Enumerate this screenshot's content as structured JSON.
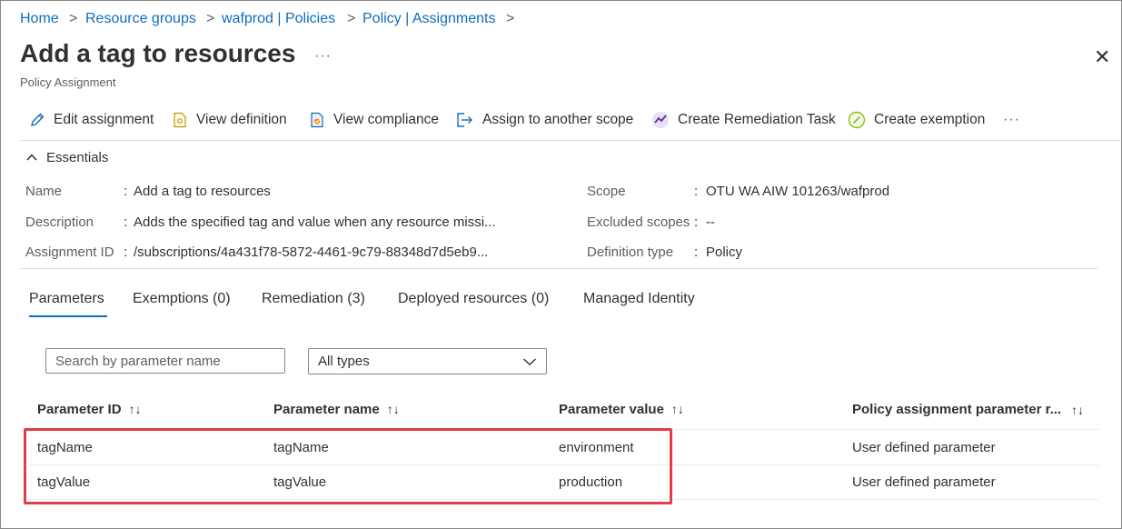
{
  "breadcrumb": {
    "items": [
      {
        "label": "Home"
      },
      {
        "label": "Resource groups"
      },
      {
        "label": "wafprod | Policies"
      },
      {
        "label": "Policy | Assignments"
      }
    ],
    "separator": ">"
  },
  "header": {
    "title": "Add a tag to resources",
    "subtitle": "Policy Assignment",
    "more": "···",
    "close": "✕"
  },
  "toolbar": {
    "items": [
      {
        "label": "Edit assignment",
        "icon": "pencil-icon"
      },
      {
        "label": "View definition",
        "icon": "document-icon"
      },
      {
        "label": "View compliance",
        "icon": "compliance-icon"
      },
      {
        "label": "Assign to another scope",
        "icon": "export-icon"
      },
      {
        "label": "Create Remediation Task",
        "icon": "remediation-icon"
      },
      {
        "label": "Create exemption",
        "icon": "exemption-icon"
      }
    ],
    "more": "···"
  },
  "essentials": {
    "heading": "Essentials",
    "left": [
      {
        "label": "Name",
        "value": "Add a tag to resources"
      },
      {
        "label": "Description",
        "value": "Adds the specified tag and value when any resource missi..."
      },
      {
        "label": "Assignment ID",
        "value": "/subscriptions/4a431f78-5872-4461-9c79-88348d7d5eb9..."
      }
    ],
    "right": [
      {
        "label": "Scope",
        "value": "OTU WA AIW 101263/wafprod"
      },
      {
        "label": "Excluded scopes",
        "value": "--"
      },
      {
        "label": "Definition type",
        "value": "Policy"
      }
    ]
  },
  "tabs": [
    {
      "label": "Parameters",
      "active": true
    },
    {
      "label": "Exemptions (0)"
    },
    {
      "label": "Remediation (3)"
    },
    {
      "label": "Deployed resources (0)"
    },
    {
      "label": "Managed Identity"
    }
  ],
  "filters": {
    "search_placeholder": "Search by parameter name",
    "type_value": "All types"
  },
  "table": {
    "columns": [
      {
        "label": "Parameter ID",
        "sort": "↑↓"
      },
      {
        "label": "Parameter name",
        "sort": "↑↓"
      },
      {
        "label": "Parameter value",
        "sort": "↑↓"
      },
      {
        "label": "Policy assignment parameter r...",
        "sort": "↑↓"
      }
    ],
    "rows": [
      [
        "tagName",
        "tagName",
        "environment",
        "User defined parameter"
      ],
      [
        "tagValue",
        "tagValue",
        "production",
        "User defined parameter"
      ]
    ]
  },
  "colors": {
    "link": "#0f6cbd",
    "highlight": "#e03e49",
    "text": "#323130"
  }
}
